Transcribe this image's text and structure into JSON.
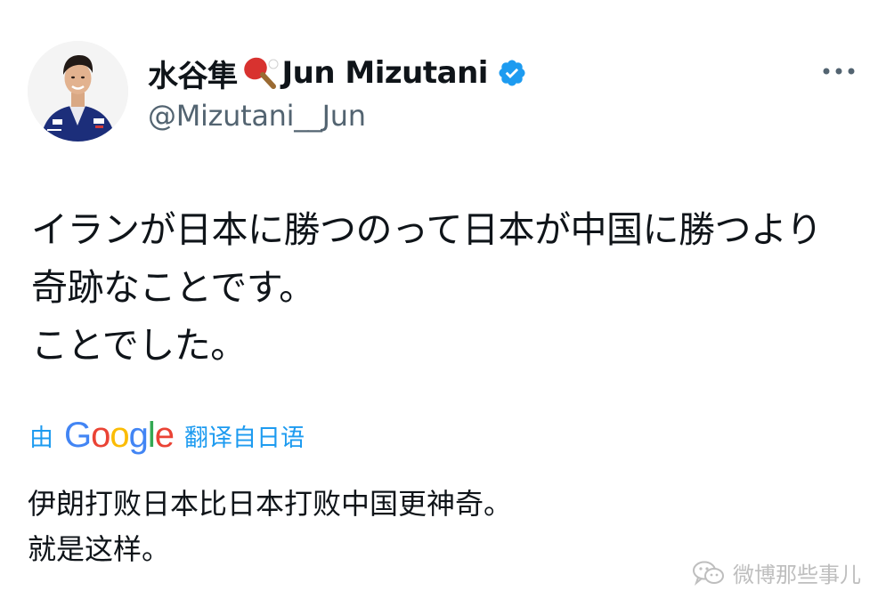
{
  "author": {
    "display_name": "水谷隼",
    "display_name_en": "Jun Mizutani",
    "handle": "@Mizutani__Jun",
    "verified": true
  },
  "tweet": {
    "text": "イランが日本に勝つのって日本が中国に勝つより奇跡なことです。\nことでした。"
  },
  "translation": {
    "prefix": "由",
    "engine": "Google",
    "suffix": "翻译自日语",
    "text": "伊朗打败日本比日本打败中国更神奇。\n就是这样。"
  },
  "watermark": {
    "text": "微博那些事儿"
  },
  "icons": {
    "paddle": "table-tennis-paddle-icon",
    "verified": "verified-badge-icon",
    "more": "more-options-icon",
    "watermark": "wechat-icon"
  },
  "colors": {
    "text": "#0f1419",
    "secondary": "#536471",
    "link": "#1d9bf0",
    "verified": "#1d9bf0"
  }
}
